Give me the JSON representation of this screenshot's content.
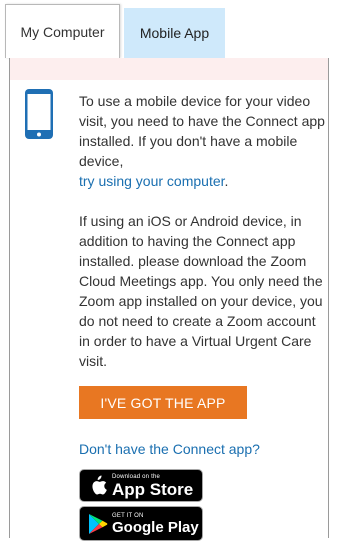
{
  "tabs": [
    {
      "label": "My Computer"
    },
    {
      "label": "Mobile App"
    }
  ],
  "content": {
    "para1": "To use a mobile device for your video visit, you need to have the Connect app installed. If you don't have a mobile device,",
    "computer_link": "try using your computer",
    "link_suffix": ".",
    "para2": "If using an iOS or Android device, in addition to having the Connect app installed. please download the Zoom Cloud Meetings app. You only need the Zoom app installed on your device, you do not need to create a Zoom account in order to have a Virtual Urgent Care visit.",
    "got_app_button": "I'VE GOT THE APP",
    "no_app_link": "Don't have the Connect app?"
  },
  "badges": {
    "app_store": {
      "small": "Download on the",
      "big": "App Store"
    },
    "google_play": {
      "small": "GET IT ON",
      "big": "Google Play"
    }
  },
  "colors": {
    "active_tab": "#cfe9fb",
    "banner": "#fdeeee",
    "accent_button": "#e87722",
    "link": "#1a6fb0",
    "icon_blue": "#1f6fb4"
  },
  "icons": {
    "device": "mobile-phone-icon",
    "apple": "apple-logo-icon",
    "google_play": "google-play-logo-icon"
  }
}
